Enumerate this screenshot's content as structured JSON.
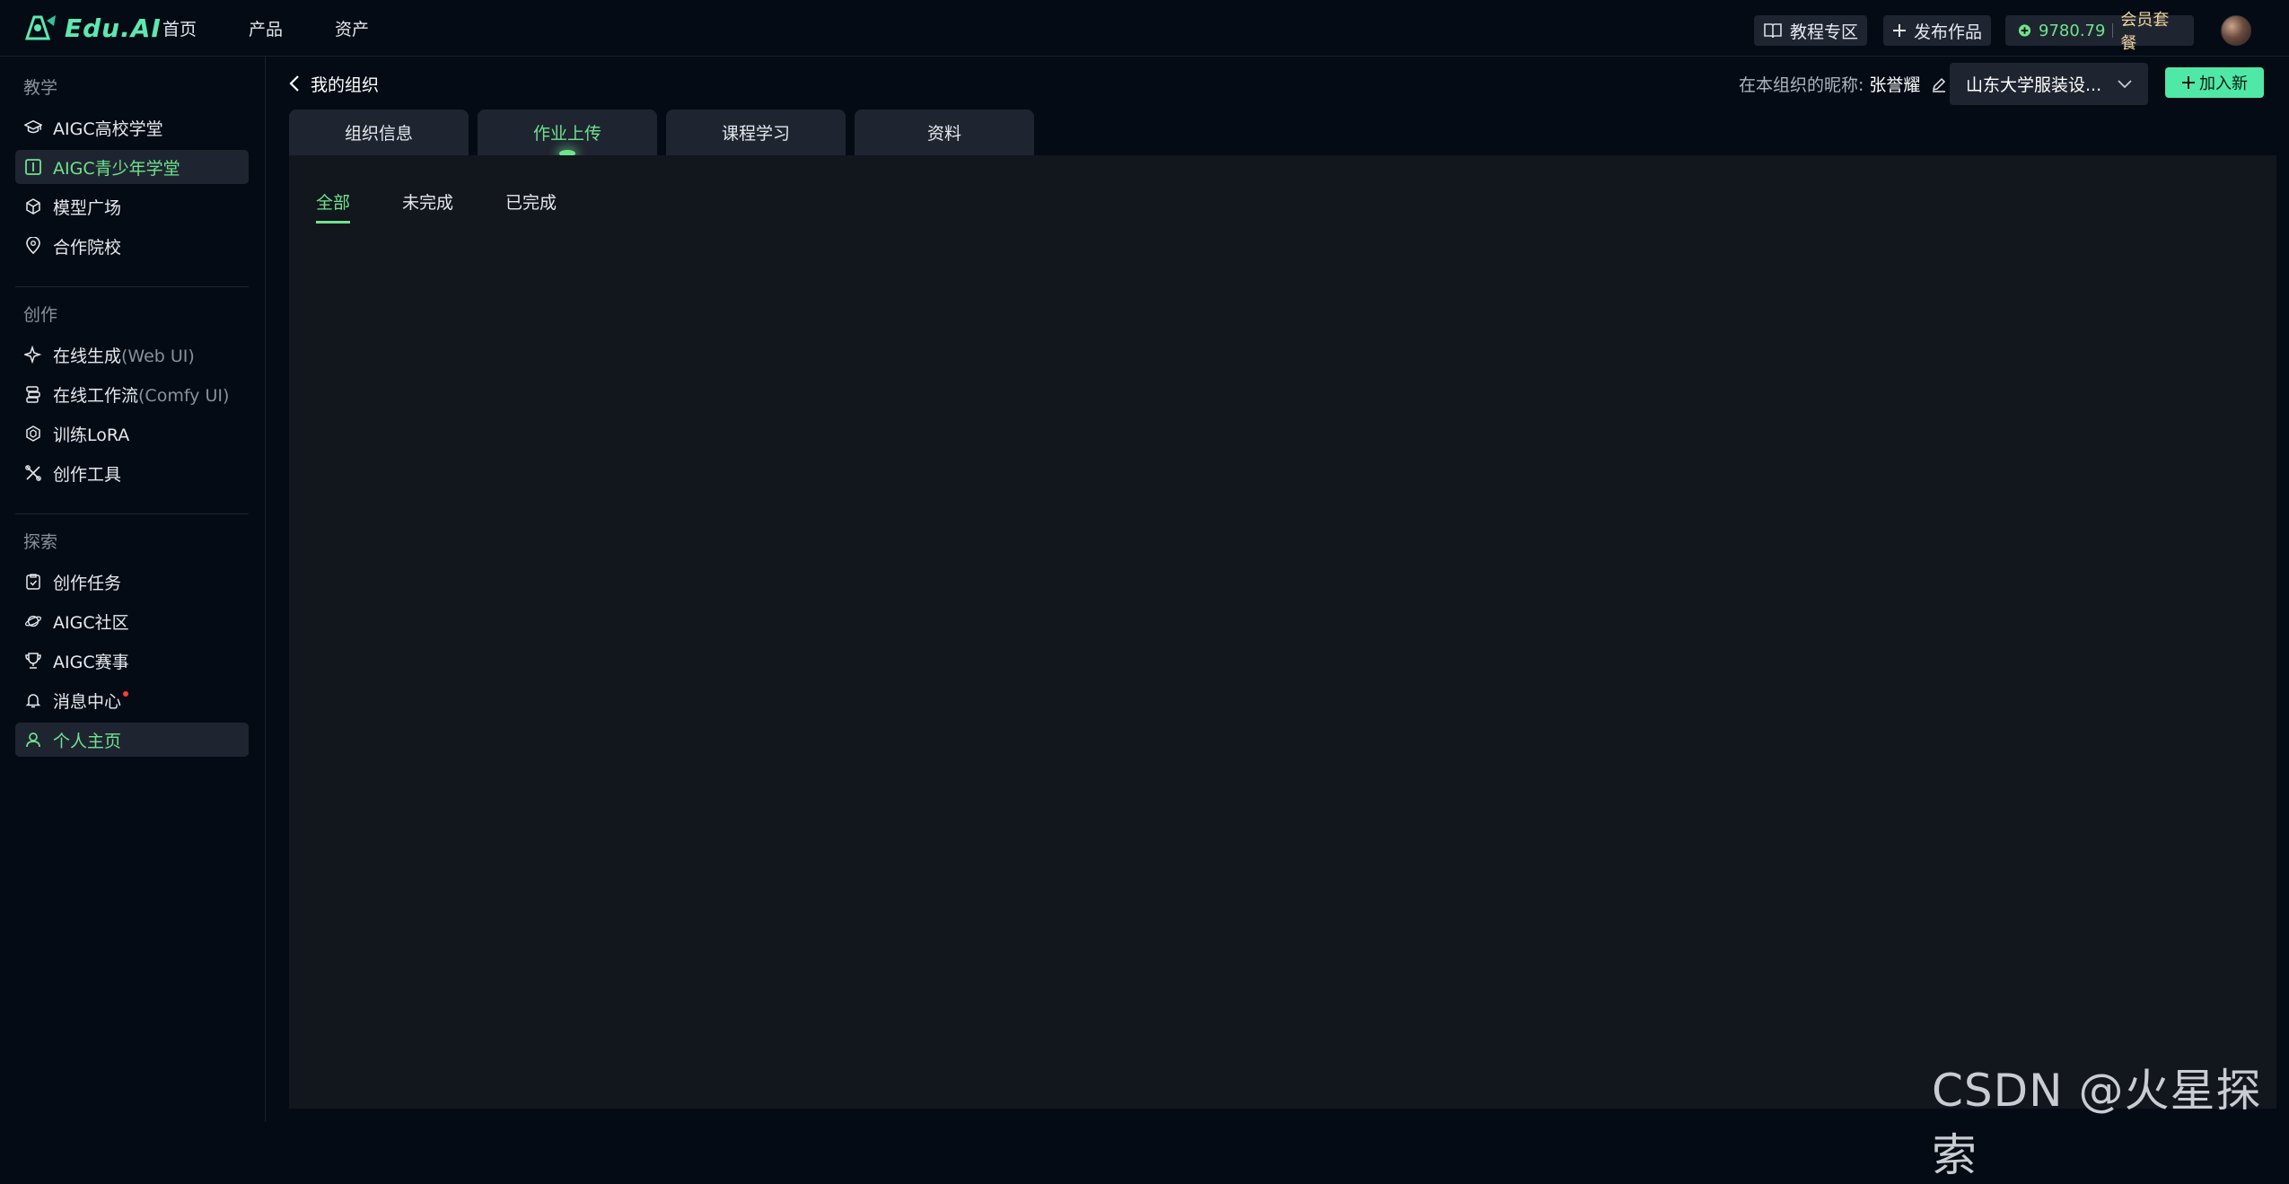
{
  "app": {
    "logo_text": "Edu.AI"
  },
  "topnav": [
    "首页",
    "产品",
    "资产"
  ],
  "header": {
    "tutorial_label": "教程专区",
    "publish_label": "发布作品",
    "points": "9780.79",
    "vip_label": "会员套餐"
  },
  "sidebar": {
    "sections": [
      {
        "title": "教学",
        "items": [
          {
            "label": "AIGC高校学堂",
            "icon": "graduation-cap-icon"
          },
          {
            "label": "AIGC青少年学堂",
            "icon": "book-icon",
            "active": true
          },
          {
            "label": "模型广场",
            "icon": "cube-icon"
          },
          {
            "label": "合作院校",
            "icon": "location-pin-icon"
          }
        ]
      },
      {
        "title": "创作",
        "items": [
          {
            "label": "在线生成",
            "suffix": "(Web UI)",
            "icon": "sparkle-icon"
          },
          {
            "label": "在线工作流",
            "suffix": "(Comfy UI)",
            "icon": "workflow-icon"
          },
          {
            "label": "训练LoRA",
            "icon": "layers-icon"
          },
          {
            "label": "创作工具",
            "icon": "tools-icon"
          }
        ]
      },
      {
        "title": "探索",
        "items": [
          {
            "label": "创作任务",
            "icon": "clipboard-icon"
          },
          {
            "label": "AIGC社区",
            "icon": "planet-icon"
          },
          {
            "label": "AIGC赛事",
            "icon": "trophy-icon"
          },
          {
            "label": "消息中心",
            "icon": "bell-icon",
            "badge": true
          },
          {
            "label": "个人主页",
            "icon": "user-icon",
            "active": true
          }
        ]
      }
    ]
  },
  "main": {
    "back_label": "我的组织",
    "nickname_label": "在本组织的昵称:",
    "nickname": "张誉耀",
    "org_selected": "山东大学服装设...",
    "join_label": "加入新",
    "tabs": [
      "组织信息",
      "作业上传",
      "课程学习",
      "资料"
    ],
    "active_tab": 1,
    "subtabs": [
      "全部",
      "未完成",
      "已完成"
    ],
    "active_subtab": 0
  },
  "watermark": "CSDN @火星探索",
  "colors": {
    "accent": "#6fe38d",
    "brand": "#4fe8a6",
    "bg": "#050b14",
    "panel": "#12161d",
    "chip": "#1f2530"
  }
}
